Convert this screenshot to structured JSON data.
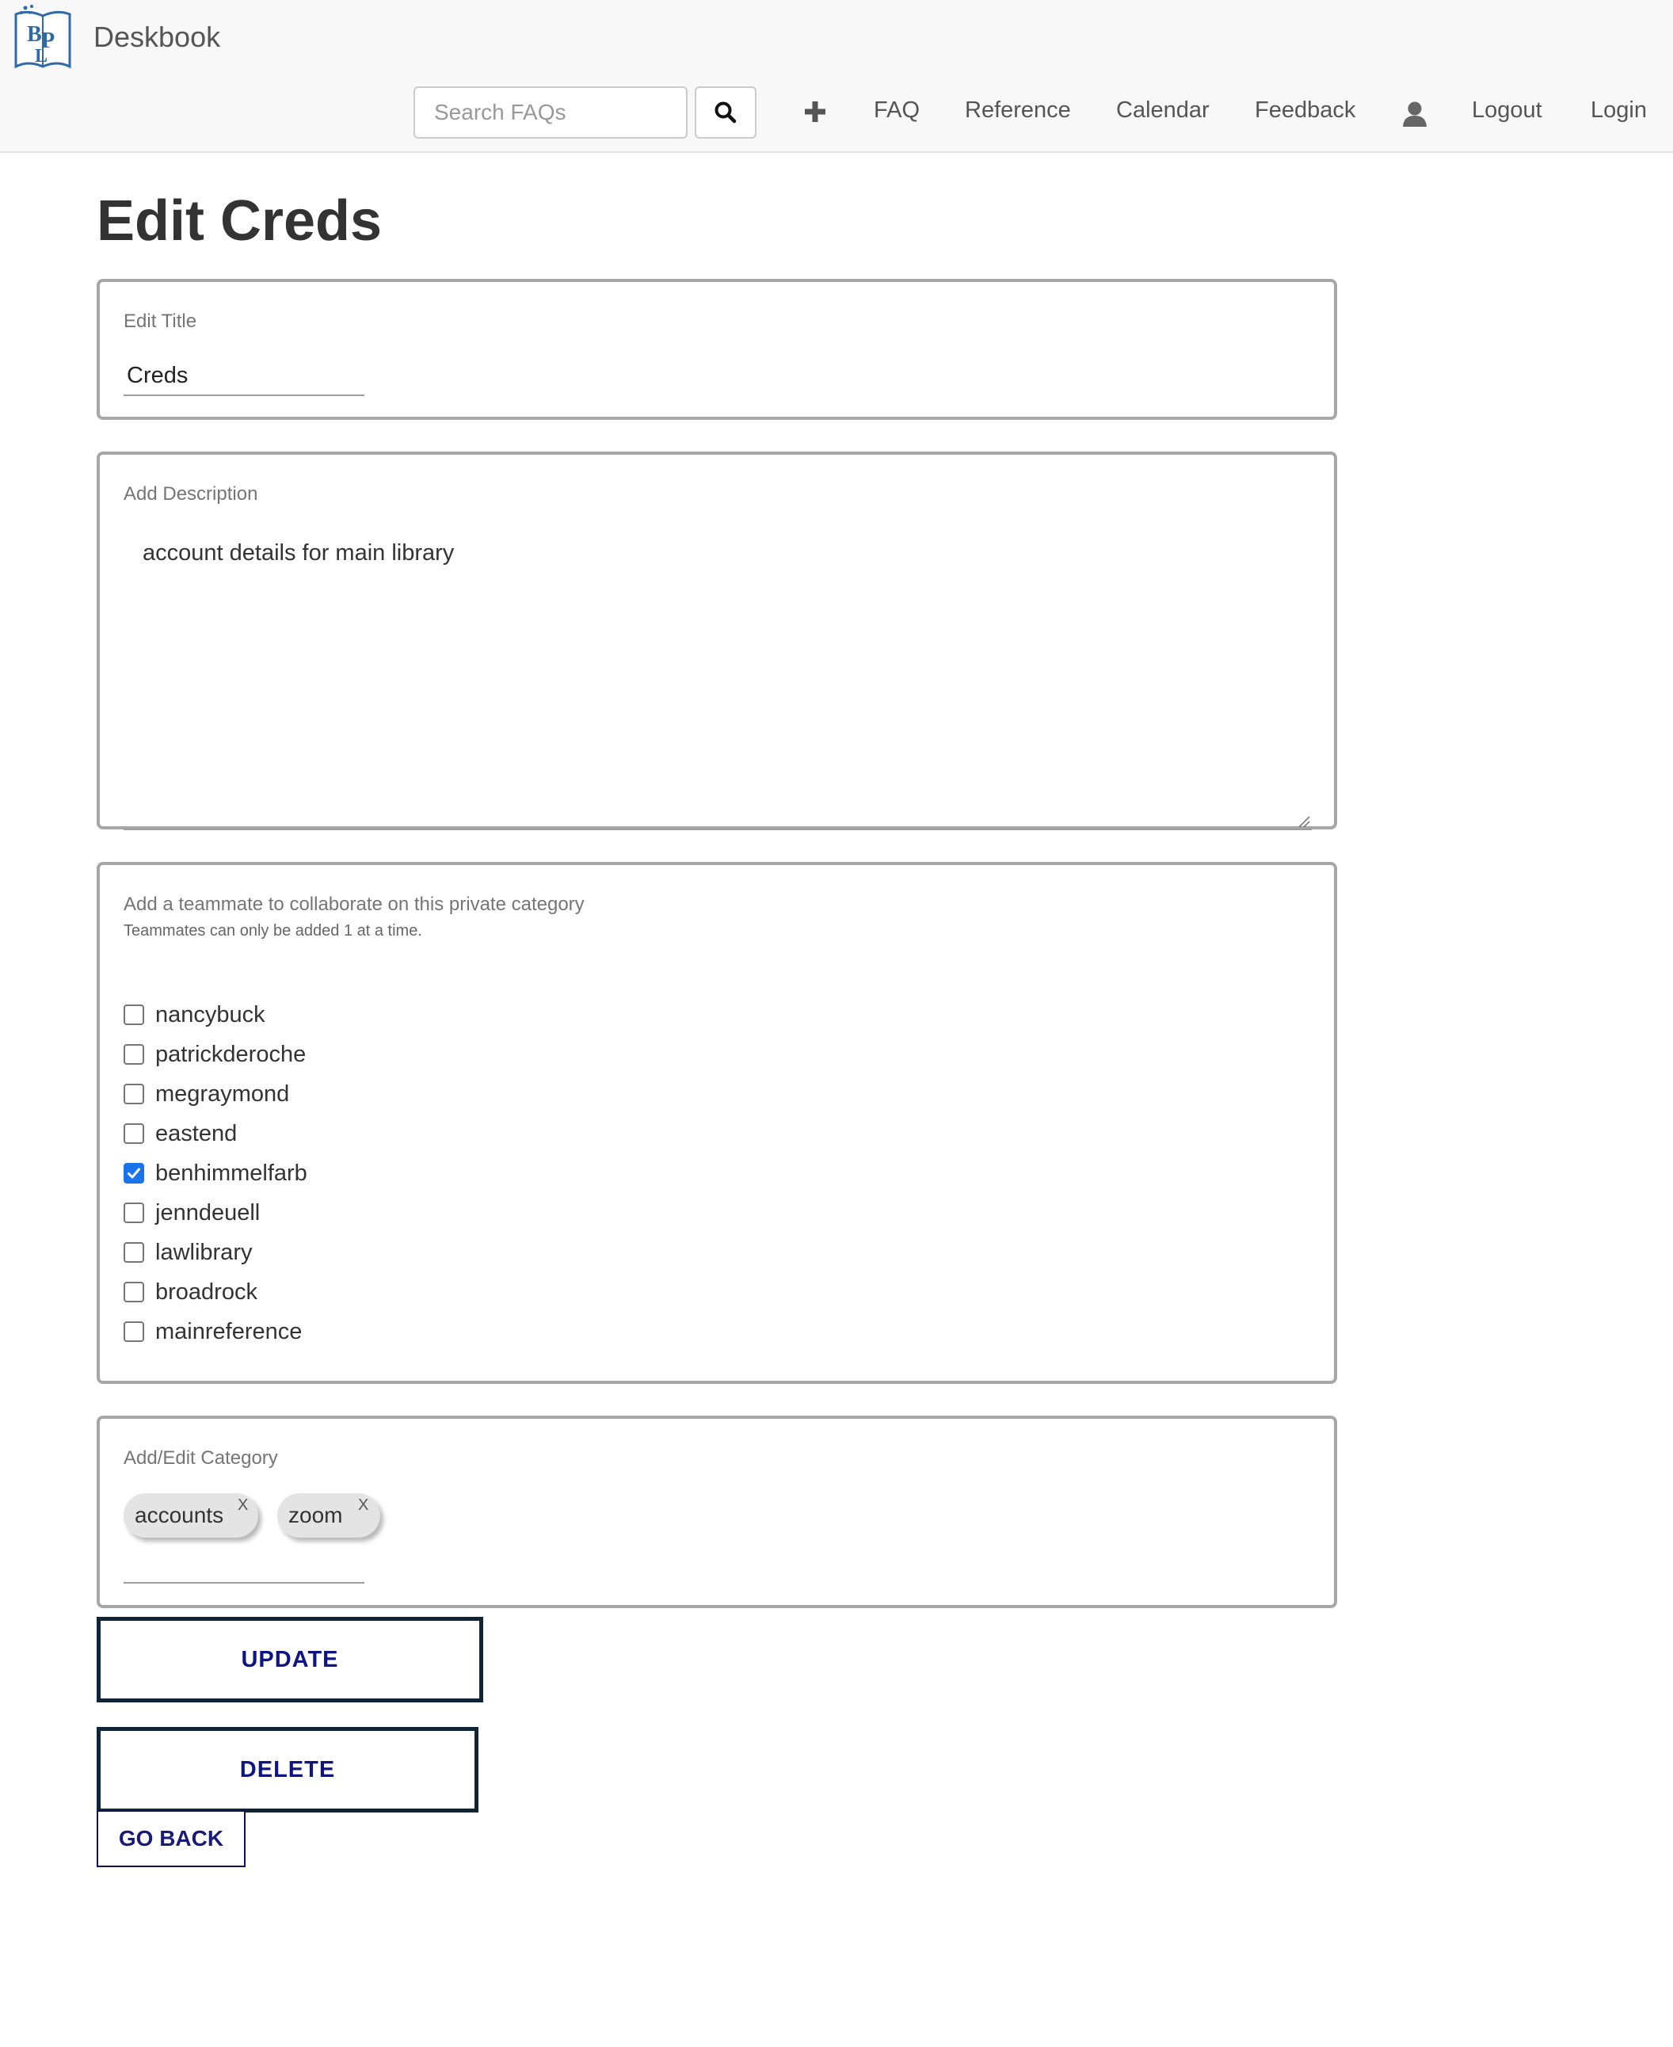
{
  "navbar": {
    "logo_text": "BPL",
    "brand": "Deskbook",
    "search_placeholder": "Search FAQs",
    "links": [
      "FAQ",
      "Reference",
      "Calendar",
      "Feedback"
    ],
    "logout": "Logout",
    "login": "Login"
  },
  "page": {
    "title": "Edit Creds"
  },
  "title_field": {
    "label": "Edit Title",
    "value": "Creds"
  },
  "description_field": {
    "label": "Add Description",
    "value": "account details for main library"
  },
  "teammates": {
    "label": "Add a teammate to collaborate on this private category",
    "hint": "Teammates can only be added 1 at a time.",
    "items": [
      {
        "name": "nancybuck",
        "checked": false
      },
      {
        "name": "patrickderoche",
        "checked": false
      },
      {
        "name": "megraymond",
        "checked": false
      },
      {
        "name": "eastend",
        "checked": false
      },
      {
        "name": "benhimmelfarb",
        "checked": true
      },
      {
        "name": "jenndeuell",
        "checked": false
      },
      {
        "name": "lawlibrary",
        "checked": false
      },
      {
        "name": "broadrock",
        "checked": false
      },
      {
        "name": "mainreference",
        "checked": false
      }
    ]
  },
  "category": {
    "label": "Add/Edit Category",
    "chips": [
      "accounts",
      "zoom"
    ],
    "remove_symbol": "X"
  },
  "buttons": {
    "update": "UPDATE",
    "delete": "DELETE",
    "go_back": "GO BACK"
  },
  "colors": {
    "checkbox_checked": "#1a73e8",
    "button_text": "#101480",
    "button_border": "#0f2435"
  }
}
